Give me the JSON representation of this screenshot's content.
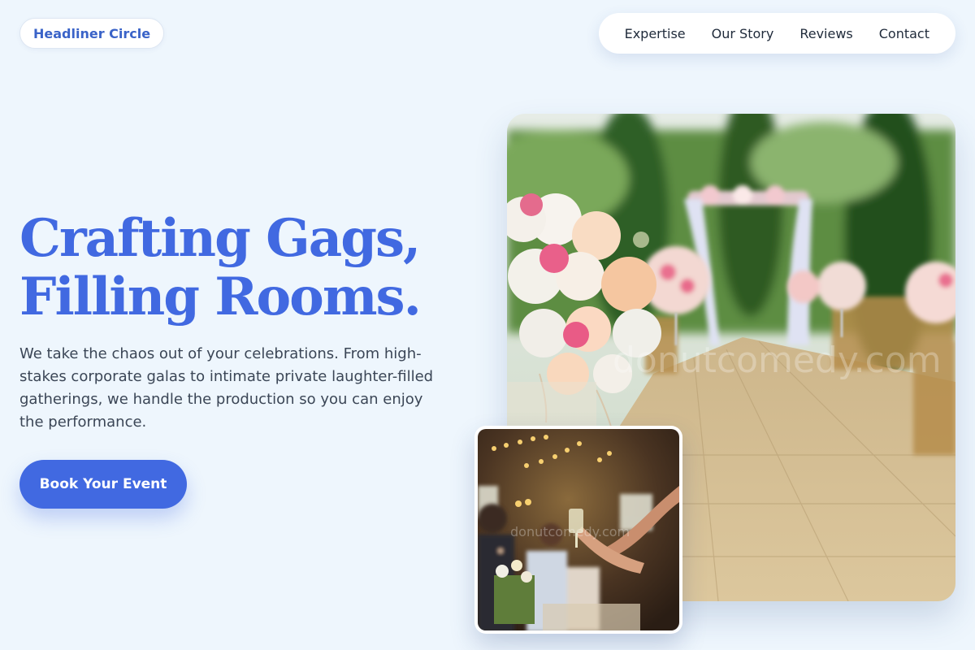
{
  "brand": {
    "name": "Headliner Circle"
  },
  "nav": {
    "items": [
      {
        "label": "Expertise"
      },
      {
        "label": "Our Story"
      },
      {
        "label": "Reviews"
      },
      {
        "label": "Contact"
      }
    ]
  },
  "hero": {
    "title_line1": "Crafting Gags,",
    "title_line2": "Filling Rooms.",
    "description": "We take the chaos out of your celebrations. From high-stakes corporate galas to intimate private laughter-filled gatherings, we handle the production so you can enjoy the performance.",
    "cta_label": "Book Your Event"
  },
  "images": {
    "main_watermark": "donutcomedy.com",
    "small_watermark": "donutcomedy.com"
  },
  "colors": {
    "accent": "#4169e1",
    "background": "#eef6fd",
    "text": "#3b4656"
  }
}
